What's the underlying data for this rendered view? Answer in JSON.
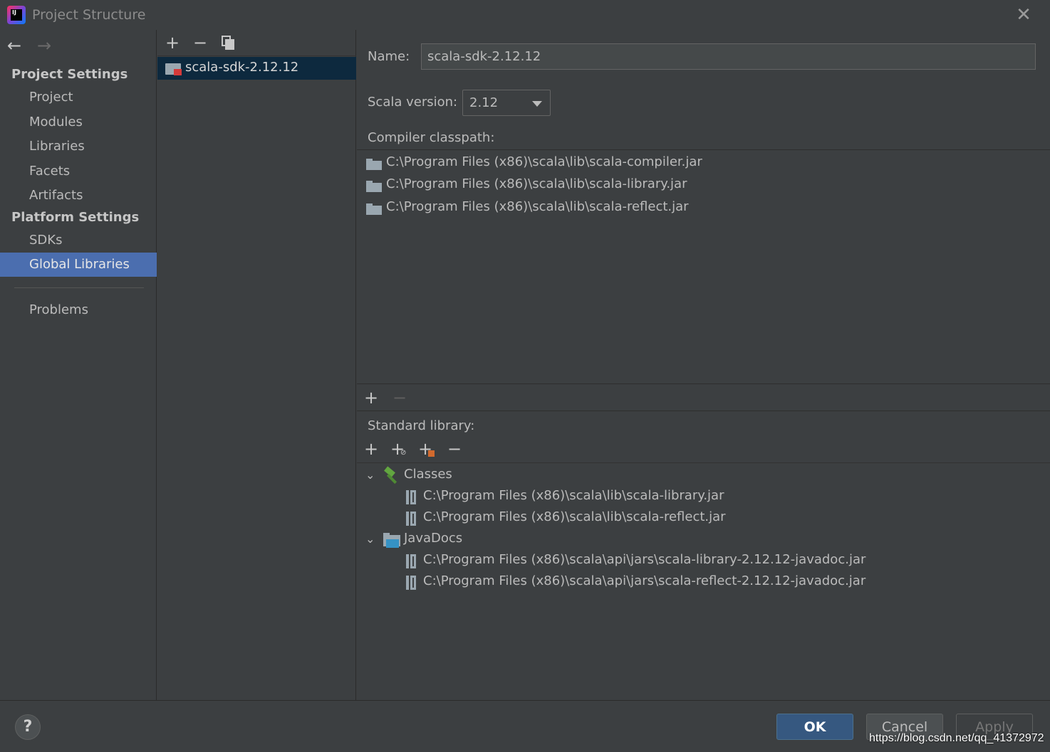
{
  "window": {
    "title": "Project Structure"
  },
  "nav": {
    "project_settings": "Project Settings",
    "project_items": [
      "Project",
      "Modules",
      "Libraries",
      "Facets",
      "Artifacts"
    ],
    "platform_settings": "Platform Settings",
    "platform_items": [
      "SDKs",
      "Global Libraries"
    ],
    "problems": "Problems",
    "active": "Global Libraries"
  },
  "libraries": {
    "items": [
      "scala-sdk-2.12.12"
    ],
    "selected": "scala-sdk-2.12.12"
  },
  "detail": {
    "name_label": "Name:",
    "name_value": "scala-sdk-2.12.12",
    "scala_version_label": "Scala version:",
    "scala_version_value": "2.12",
    "compiler_classpath_label": "Compiler classpath:",
    "compiler_classpath": [
      "C:\\Program Files (x86)\\scala\\lib\\scala-compiler.jar",
      "C:\\Program Files (x86)\\scala\\lib\\scala-library.jar",
      "C:\\Program Files (x86)\\scala\\lib\\scala-reflect.jar"
    ],
    "standard_library_label": "Standard library:",
    "classes_label": "Classes",
    "classes": [
      "C:\\Program Files (x86)\\scala\\lib\\scala-library.jar",
      "C:\\Program Files (x86)\\scala\\lib\\scala-reflect.jar"
    ],
    "javadocs_label": "JavaDocs",
    "javadocs": [
      "C:\\Program Files (x86)\\scala\\api\\jars\\scala-library-2.12.12-javadoc.jar",
      "C:\\Program Files (x86)\\scala\\api\\jars\\scala-reflect-2.12.12-javadoc.jar"
    ]
  },
  "footer": {
    "help": "?",
    "ok": "OK",
    "cancel": "Cancel",
    "apply": "Apply",
    "watermark": "https://blog.csdn.net/qq_41372972"
  },
  "colors": {
    "selection": "#4b6eaf",
    "list_selection": "#0d293e",
    "ok_button": "#365880"
  }
}
